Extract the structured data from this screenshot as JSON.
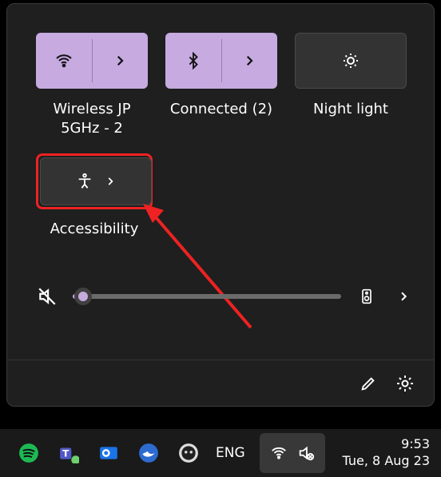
{
  "tiles": {
    "wifi": {
      "label": "Wireless JP 5GHz - 2",
      "active": true
    },
    "bluetooth": {
      "label": "Connected (2)",
      "active": true
    },
    "nightlight": {
      "label": "Night light",
      "active": false
    }
  },
  "accessibility": {
    "label": "Accessibility",
    "highlighted": true
  },
  "volume": {
    "muted": true,
    "level_percent": 4
  },
  "footer": {
    "edit": "Edit quick settings",
    "settings": "Settings"
  },
  "taskbar": {
    "apps": [
      "spotify",
      "teams",
      "outlook",
      "thunderbird",
      "github-desktop"
    ],
    "language": "ENG",
    "tray": [
      "wifi",
      "volume-muted"
    ],
    "clock": {
      "time": "9:53",
      "date": "Tue, 8 Aug 23"
    }
  },
  "colors": {
    "accent": "#c6aae0",
    "panel": "#1f1f1f",
    "highlight": "#e22"
  }
}
